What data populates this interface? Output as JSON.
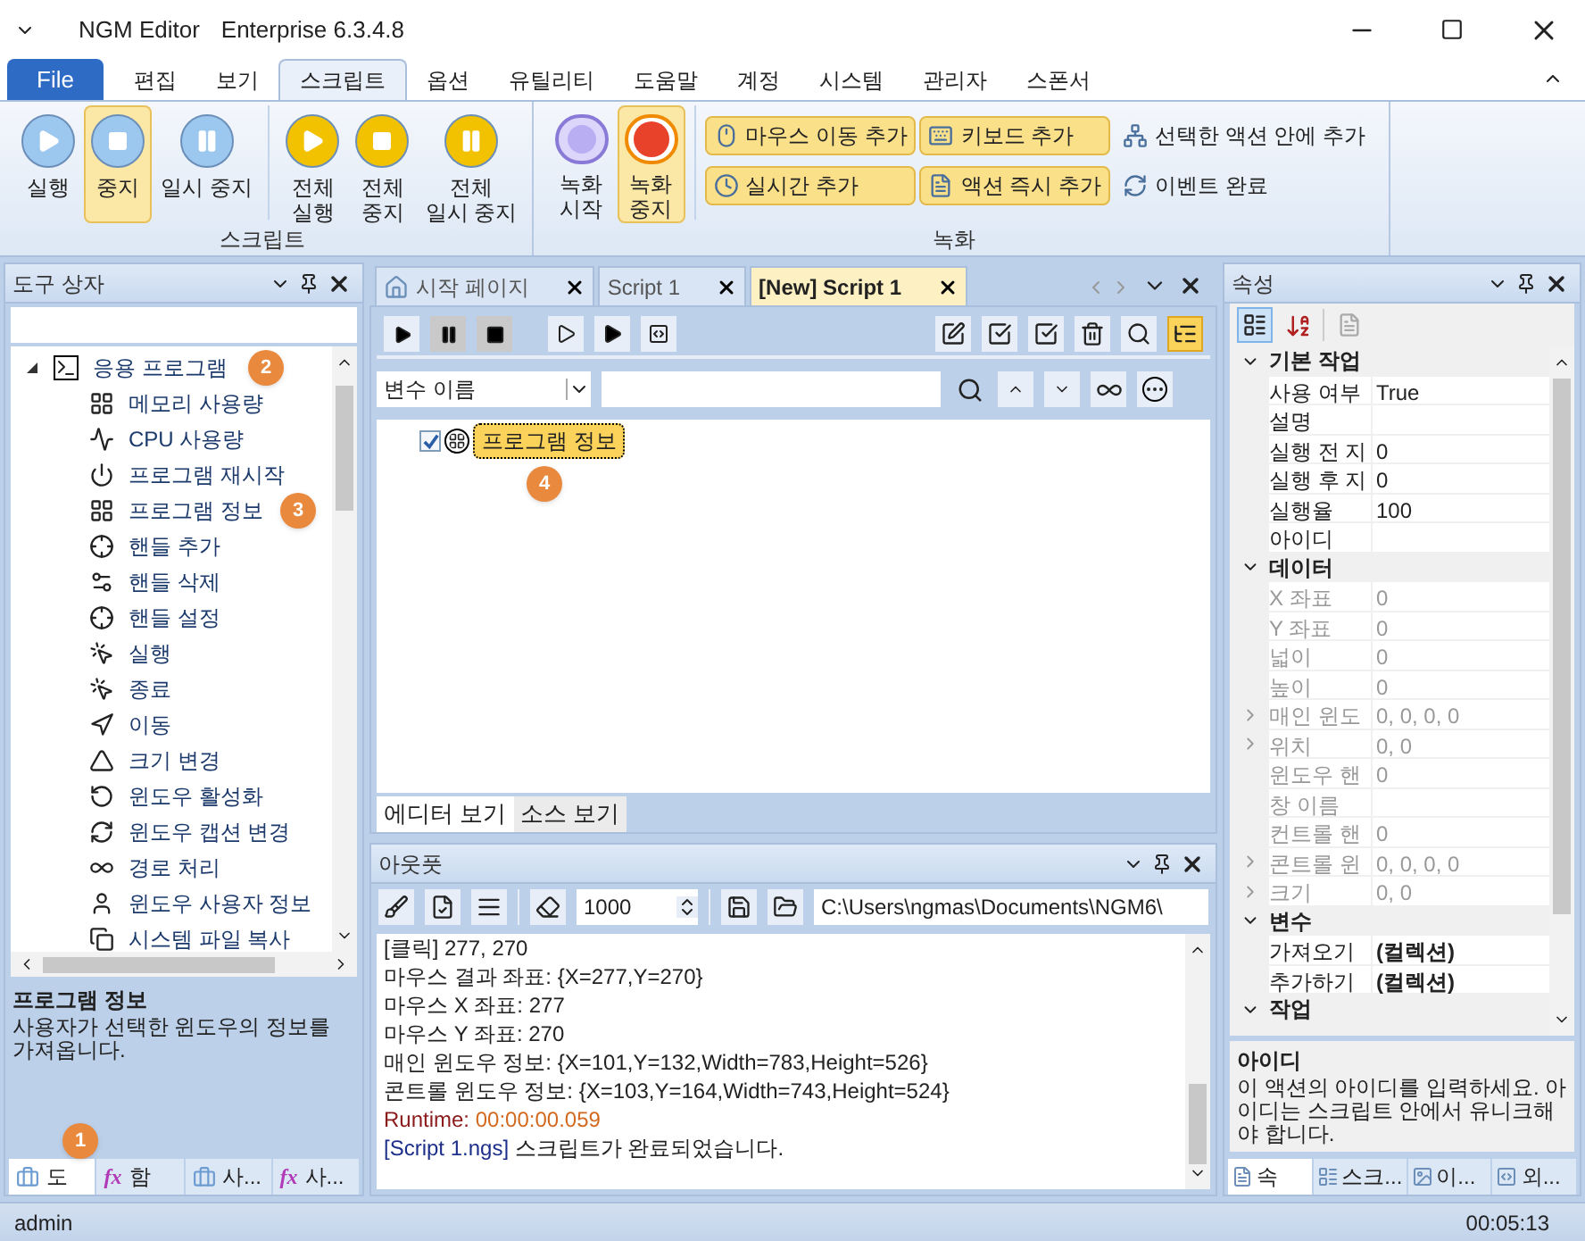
{
  "window": {
    "app_name": "NGM Editor",
    "edition": "Enterprise 6.3.4.8"
  },
  "menu_tabs": [
    {
      "label": "File",
      "kind": "file",
      "selected": false
    },
    {
      "label": "편집",
      "kind": "tab",
      "selected": false
    },
    {
      "label": "보기",
      "kind": "tab",
      "selected": false
    },
    {
      "label": "스크립트",
      "kind": "tab",
      "selected": true
    },
    {
      "label": "옵션",
      "kind": "tab",
      "selected": false
    },
    {
      "label": "유틸리티",
      "kind": "tab",
      "selected": false
    },
    {
      "label": "도움말",
      "kind": "tab",
      "selected": false
    },
    {
      "label": "계정",
      "kind": "tab",
      "selected": false
    },
    {
      "label": "시스템",
      "kind": "tab",
      "selected": false
    },
    {
      "label": "관리자",
      "kind": "tab",
      "selected": false
    },
    {
      "label": "스폰서",
      "kind": "tab",
      "selected": false
    }
  ],
  "ribbon": {
    "script_group": {
      "label": "스크립트",
      "buttons": [
        {
          "lines": [
            "실행"
          ],
          "kind": "play",
          "color": "#9cc8f0",
          "selected": false
        },
        {
          "lines": [
            "중지"
          ],
          "kind": "stop",
          "color": "#9cc8f0",
          "selected": true
        },
        {
          "lines": [
            "일시 중지"
          ],
          "kind": "pause",
          "color": "#9cc8f0",
          "selected": false
        },
        {
          "lines": [
            "전체",
            "실행"
          ],
          "kind": "play",
          "color": "#f2c200",
          "selected": false
        },
        {
          "lines": [
            "전체",
            "중지"
          ],
          "kind": "stop",
          "color": "#f2c200",
          "selected": false
        },
        {
          "lines": [
            "전체",
            "일시 중지"
          ],
          "kind": "pause",
          "color": "#f2c200",
          "selected": false
        }
      ]
    },
    "record_group": {
      "label": "녹화",
      "big_buttons": [
        {
          "lines": [
            "녹화",
            "시작"
          ],
          "kind": "record-start",
          "selected": false
        },
        {
          "lines": [
            "녹화",
            "중지"
          ],
          "kind": "record-stop",
          "selected": true
        }
      ],
      "small_buttons": [
        {
          "label": "마우스 이동 추가",
          "kind": "mouse",
          "highlighted": true
        },
        {
          "label": "키보드 추가",
          "kind": "keyboard",
          "highlighted": true
        },
        {
          "label": "선택한 액션 안에 추가",
          "kind": "hierarchy",
          "highlighted": false
        },
        {
          "label": "실시간 추가",
          "kind": "clock",
          "highlighted": true
        },
        {
          "label": "액션 즉시 추가",
          "kind": "form",
          "highlighted": true
        },
        {
          "label": "이벤트 완료",
          "kind": "refresh",
          "highlighted": false
        }
      ]
    }
  },
  "toolbox": {
    "title": "도구 상자",
    "tree": [
      {
        "label": "응용 프로그램",
        "expanded": true,
        "badge": "2",
        "children": [
          {
            "label": "메모리 사용량"
          },
          {
            "label": "CPU 사용량"
          },
          {
            "label": "프로그램 재시작"
          },
          {
            "label": "프로그램 정보",
            "badge": "3"
          },
          {
            "label": "핸들 추가"
          },
          {
            "label": "핸들 삭제"
          },
          {
            "label": "핸들 설정"
          },
          {
            "label": "실행"
          },
          {
            "label": "종료"
          },
          {
            "label": "이동"
          },
          {
            "label": "크기 변경"
          },
          {
            "label": "윈도우 활성화"
          },
          {
            "label": "윈도우 캡션 변경"
          },
          {
            "label": "경로 처리"
          },
          {
            "label": "윈도우 사용자 정보"
          },
          {
            "label": "시스템 파일 복사"
          }
        ]
      }
    ],
    "description": {
      "title": "프로그램 정보",
      "text": "사용자가 선택한 윈도우의 정보를 가져옵니다."
    },
    "bottom_tabs": [
      {
        "label": "도",
        "kind": "toolbox",
        "selected": true,
        "badge": "1"
      },
      {
        "label": "함",
        "kind": "function",
        "icon": "fx",
        "selected": false
      },
      {
        "label": "사...",
        "kind": "toolbox",
        "selected": false
      },
      {
        "label": "사...",
        "kind": "function",
        "icon": "fx",
        "selected": false
      }
    ]
  },
  "document_tabs": [
    {
      "label": "시작 페이지",
      "kind": "home",
      "selected": false
    },
    {
      "label": "Script 1",
      "kind": "doc",
      "selected": false
    },
    {
      "label": "[New] Script 1",
      "kind": "doc",
      "selected": true
    }
  ],
  "editor": {
    "tree_view_on": true,
    "filter": {
      "dropdown": "변수 이름"
    },
    "actions": [
      {
        "label": "프로그램 정보",
        "checked": true,
        "selected": true,
        "badge": "4"
      }
    ],
    "view_tabs": [
      {
        "label": "에디터 보기",
        "selected": true
      },
      {
        "label": "소스 보기",
        "selected": false
      }
    ]
  },
  "output": {
    "title": "아웃풋",
    "line_limit": "1000",
    "path": "C:\\Users\\ngmas\\Documents\\NGM6\\",
    "lines": [
      {
        "kind": "plain",
        "text": "[클릭] 277, 270"
      },
      {
        "kind": "plain",
        "text": "마우스 결과 좌표: {X=277,Y=270}"
      },
      {
        "kind": "plain",
        "text": "마우스 X 좌표: 277"
      },
      {
        "kind": "plain",
        "text": "마우스 Y 좌표: 270"
      },
      {
        "kind": "plain",
        "text": "매인 윈도우 정보: {X=101,Y=132,Width=783,Height=526}"
      },
      {
        "kind": "plain",
        "text": "콘트롤 윈도우 정보: {X=103,Y=164,Width=743,Height=524}"
      },
      {
        "kind": "runtime",
        "label": "Runtime:",
        "text": "00:00:00.059"
      },
      {
        "kind": "script",
        "label": "[Script 1.ngs]",
        "text": "스크립트가 완료되었습니다."
      }
    ]
  },
  "properties": {
    "title": "속성",
    "categorized": true,
    "categories": [
      {
        "name": "기본 작업",
        "expanded": true,
        "rows": [
          {
            "name": "사용 여부",
            "value": "True",
            "disabled": false,
            "expandable": false
          },
          {
            "name": "설명",
            "value": "",
            "disabled": false,
            "expandable": false
          },
          {
            "name": "실행 전 지",
            "value": "0",
            "disabled": false,
            "expandable": false
          },
          {
            "name": "실행 후 지",
            "value": "0",
            "disabled": false,
            "expandable": false
          },
          {
            "name": "실행율",
            "value": "100",
            "disabled": false,
            "expandable": false
          },
          {
            "name": "아이디",
            "value": "",
            "disabled": false,
            "expandable": false
          }
        ]
      },
      {
        "name": "데이터",
        "expanded": true,
        "rows": [
          {
            "name": "X 좌표",
            "value": "0",
            "disabled": true,
            "expandable": false
          },
          {
            "name": "Y 좌표",
            "value": "0",
            "disabled": true,
            "expandable": false
          },
          {
            "name": "넓이",
            "value": "0",
            "disabled": true,
            "expandable": false
          },
          {
            "name": "높이",
            "value": "0",
            "disabled": true,
            "expandable": false
          },
          {
            "name": "매인 윈도",
            "value": "0, 0, 0, 0",
            "disabled": true,
            "expandable": true
          },
          {
            "name": "위치",
            "value": "0, 0",
            "disabled": true,
            "expandable": true
          },
          {
            "name": "윈도우 핸",
            "value": "0",
            "disabled": true,
            "expandable": false
          },
          {
            "name": "창 이름",
            "value": "",
            "disabled": true,
            "expandable": false
          },
          {
            "name": "컨트롤 핸",
            "value": "0",
            "disabled": true,
            "expandable": false
          },
          {
            "name": "콘트롤 윈",
            "value": "0, 0, 0, 0",
            "disabled": true,
            "expandable": true
          },
          {
            "name": "크기",
            "value": "0, 0",
            "disabled": true,
            "expandable": true
          }
        ]
      },
      {
        "name": "변수",
        "expanded": true,
        "rows": [
          {
            "name": "가져오기",
            "value": "(컬렉션)",
            "disabled": false,
            "expandable": false,
            "bold": true
          },
          {
            "name": "추가하기",
            "value": "(컬렉션)",
            "disabled": false,
            "expandable": false,
            "bold": true
          }
        ]
      },
      {
        "name": "작업",
        "expanded": true
      }
    ],
    "description": {
      "title": "아이디",
      "text": "이 액션의 아이디를 입력하세요. 아이디는 스크립트 안에서 유니크해야 합니다."
    },
    "bottom_tabs": [
      {
        "label": "속",
        "selected": true
      },
      {
        "label": "스크...",
        "selected": false
      },
      {
        "label": "이...",
        "selected": false
      },
      {
        "label": "외...",
        "selected": false
      }
    ]
  },
  "status_bar": {
    "user": "admin",
    "time": "00:05:13"
  }
}
